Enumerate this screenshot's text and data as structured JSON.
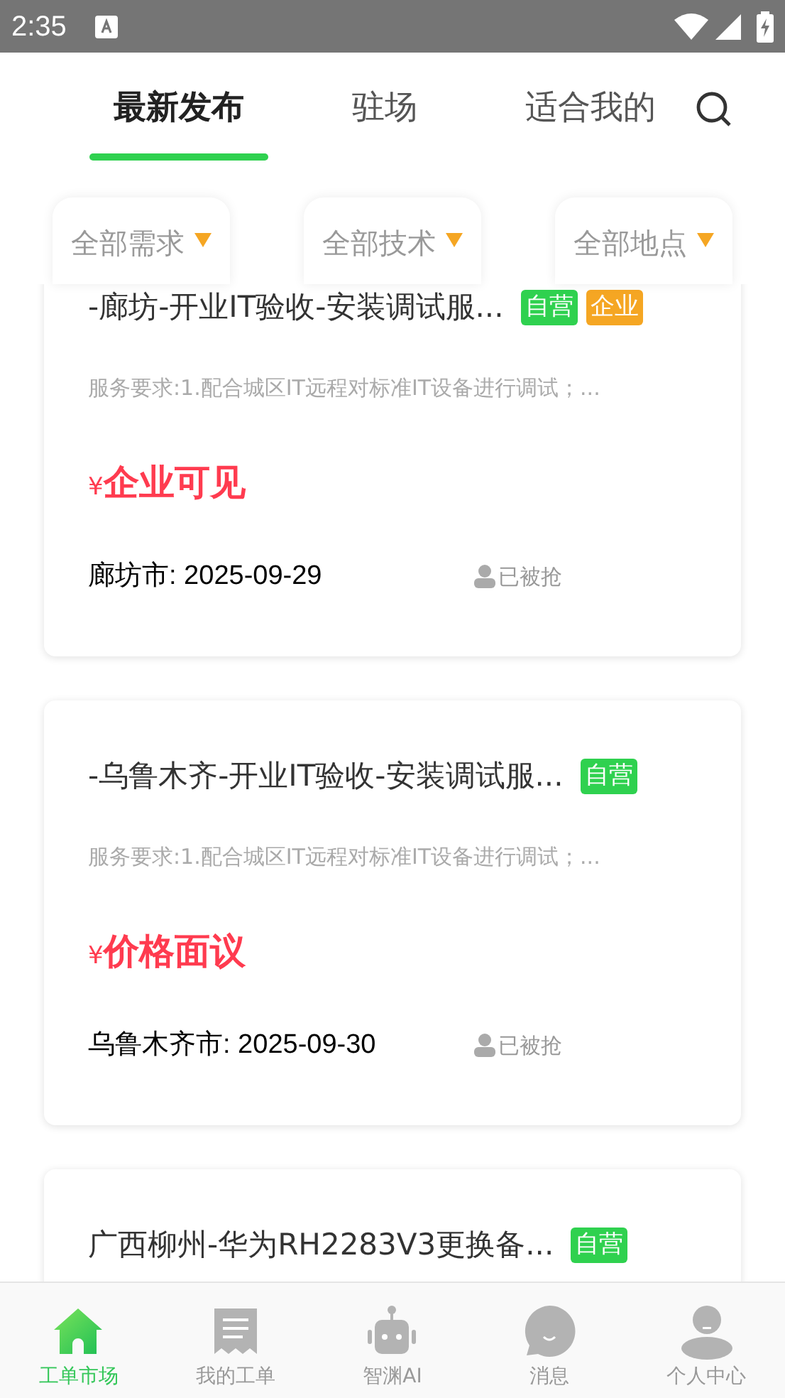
{
  "status_bar": {
    "time": "2:35"
  },
  "tabs": [
    {
      "label": "最新发布",
      "selected": true
    },
    {
      "label": "驻场",
      "selected": false
    },
    {
      "label": "适合我的",
      "selected": false
    }
  ],
  "filters": [
    "全部需求",
    "全部技术",
    "全部地点"
  ],
  "orders": [
    {
      "title": "-廊坊-开业IT验收-安装调试服...",
      "tags": [
        {
          "label": "自营",
          "color": "#2fd14f"
        },
        {
          "label": "企业",
          "color": "#f5a623"
        }
      ],
      "description": "服务要求:1.配合城区IT远程对标准IT设备进行调试；...",
      "currency": "¥",
      "price": "企业可见",
      "location_date": "廊坊市: 2025-09-29",
      "status": "已被抢"
    },
    {
      "title": "-乌鲁木齐-开业IT验收-安装调试服...",
      "tags": [
        {
          "label": "自营",
          "color": "#2fd14f"
        }
      ],
      "description": "服务要求:1.配合城区IT远程对标准IT设备进行调试；...",
      "currency": "¥",
      "price": "价格面议",
      "location_date": "乌鲁木齐市: 2025-09-30",
      "status": "已被抢"
    },
    {
      "title": "广西柳州-华为RH2283V3更换备...",
      "tags": [
        {
          "label": "自营",
          "color": "#2fd14f"
        }
      ]
    }
  ],
  "nav": [
    {
      "label": "工单市场",
      "kind": "home",
      "selected": true
    },
    {
      "label": "我的工单",
      "kind": "receipt",
      "selected": false
    },
    {
      "label": "智渊AI",
      "kind": "robot",
      "selected": false
    },
    {
      "label": "消息",
      "kind": "chat",
      "selected": false
    },
    {
      "label": "个人中心",
      "kind": "person",
      "selected": false
    }
  ]
}
